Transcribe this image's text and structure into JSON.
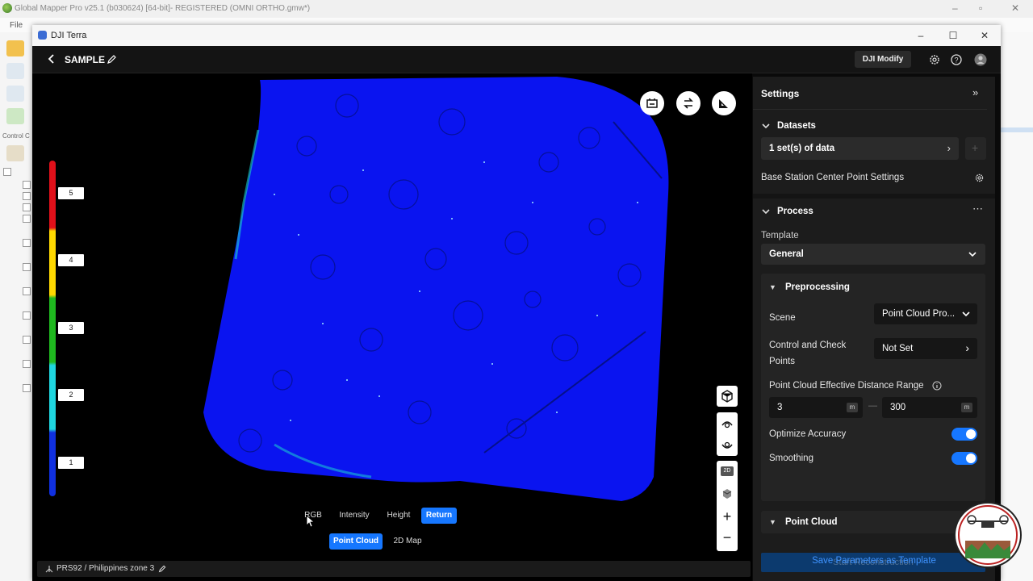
{
  "host_app": {
    "title": "Global Mapper Pro v25.1 (b030624) [64-bit]- REGISTERED (OMNI ORTHO.gmw*)",
    "menu_first": "File",
    "control_label": "Control C"
  },
  "window": {
    "title": "DJI Terra"
  },
  "header": {
    "project_name": "SAMPLE",
    "modify_label": "DJI Modify"
  },
  "legend": {
    "ticks": [
      "5",
      "4",
      "3",
      "2",
      "1"
    ]
  },
  "color_modes": [
    "RGB",
    "Intensity",
    "Height",
    "Return"
  ],
  "active_color_mode": "Return",
  "view_modes": [
    "Point Cloud",
    "2D Map"
  ],
  "active_view_mode": "Point Cloud",
  "side_tools": {
    "label_2d": "2D"
  },
  "status": {
    "coordinate_system": "PRS92 / Philippines zone 3"
  },
  "settings": {
    "title": "Settings",
    "datasets": {
      "title": "Datasets",
      "count_label": "1 set(s) of data",
      "base_station_label": "Base Station Center Point Settings"
    },
    "process": {
      "title": "Process",
      "template_label": "Template",
      "template_value": "General",
      "preprocessing": {
        "title": "Preprocessing",
        "scene_label": "Scene",
        "scene_value": "Point Cloud Pro...",
        "control_label_line1": "Control and Check",
        "control_label_line2": "Points",
        "control_value": "Not Set",
        "distance_label": "Point Cloud Effective Distance Range",
        "distance_min": "3",
        "distance_max": "300",
        "unit": "m",
        "optimize_label": "Optimize Accuracy",
        "optimize_on": true,
        "smoothing_label": "Smoothing",
        "smoothing_on": true
      },
      "point_cloud_title": "Point Cloud"
    },
    "start_label": "Start Reconstruction",
    "save_label": "Save Parameters as Template"
  },
  "watermark": {
    "text": "GIS Drone"
  },
  "colors": {
    "accent": "#1677ff",
    "cloud": "#0a14f0",
    "panel": "#1c1c1c"
  }
}
